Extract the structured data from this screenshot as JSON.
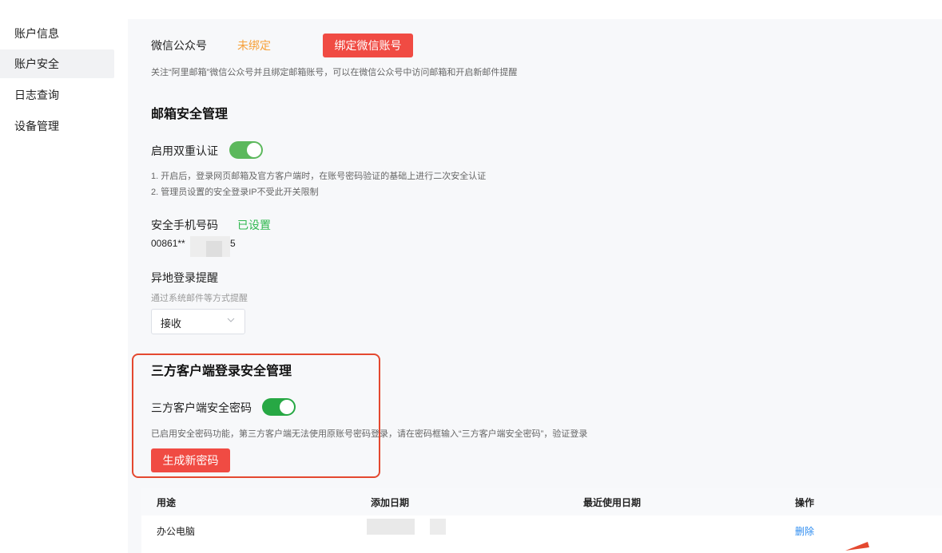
{
  "sidebar": {
    "items": [
      {
        "label": "账户信息",
        "active": false
      },
      {
        "label": "账户安全",
        "active": true
      },
      {
        "label": "日志查询",
        "active": false
      },
      {
        "label": "设备管理",
        "active": false
      }
    ]
  },
  "wechat": {
    "label": "微信公众号",
    "status": "未绑定",
    "bind_button": "绑定微信账号",
    "description": "关注“阿里邮箱”微信公众号并且绑定邮箱账号，可以在微信公众号中访问邮箱和开启新邮件提醒"
  },
  "mailbox_security": {
    "title": "邮箱安全管理",
    "two_factor": {
      "label": "启用双重认证",
      "enabled": true,
      "notes": [
        "1. 开启后，登录网页邮箱及官方客户端时，在账号密码验证的基础上进行二次安全认证",
        "2. 管理员设置的安全登录IP不受此开关限制"
      ]
    },
    "phone": {
      "label": "安全手机号码",
      "status": "已设置",
      "number_prefix": "00861**",
      "number_suffix": "5"
    },
    "remote_login": {
      "label": "异地登录提醒",
      "hint": "通过系统邮件等方式提醒",
      "selected": "接收"
    }
  },
  "third_party": {
    "title": "三方客户端登录安全管理",
    "password_toggle": {
      "label": "三方客户端安全密码",
      "enabled": true
    },
    "description": "已启用安全密码功能，第三方客户端无法使用原账号密码登录，请在密码框输入“三方客户端安全密码”，验证登录",
    "generate_button": "生成新密码"
  },
  "table": {
    "columns": [
      "用途",
      "添加日期",
      "最近使用日期",
      "操作"
    ],
    "rows": [
      {
        "purpose": "办公电脑",
        "added": "",
        "last_used": "",
        "action": "删除"
      }
    ]
  },
  "colors": {
    "accent_red": "#f04b43",
    "status_orange": "#f7a13a",
    "status_green": "#2fb84f",
    "toggle_light": "#5cb85c",
    "toggle_dark": "#27a844",
    "highlight_box": "#e4482f",
    "link_blue": "#2d8cf0"
  }
}
